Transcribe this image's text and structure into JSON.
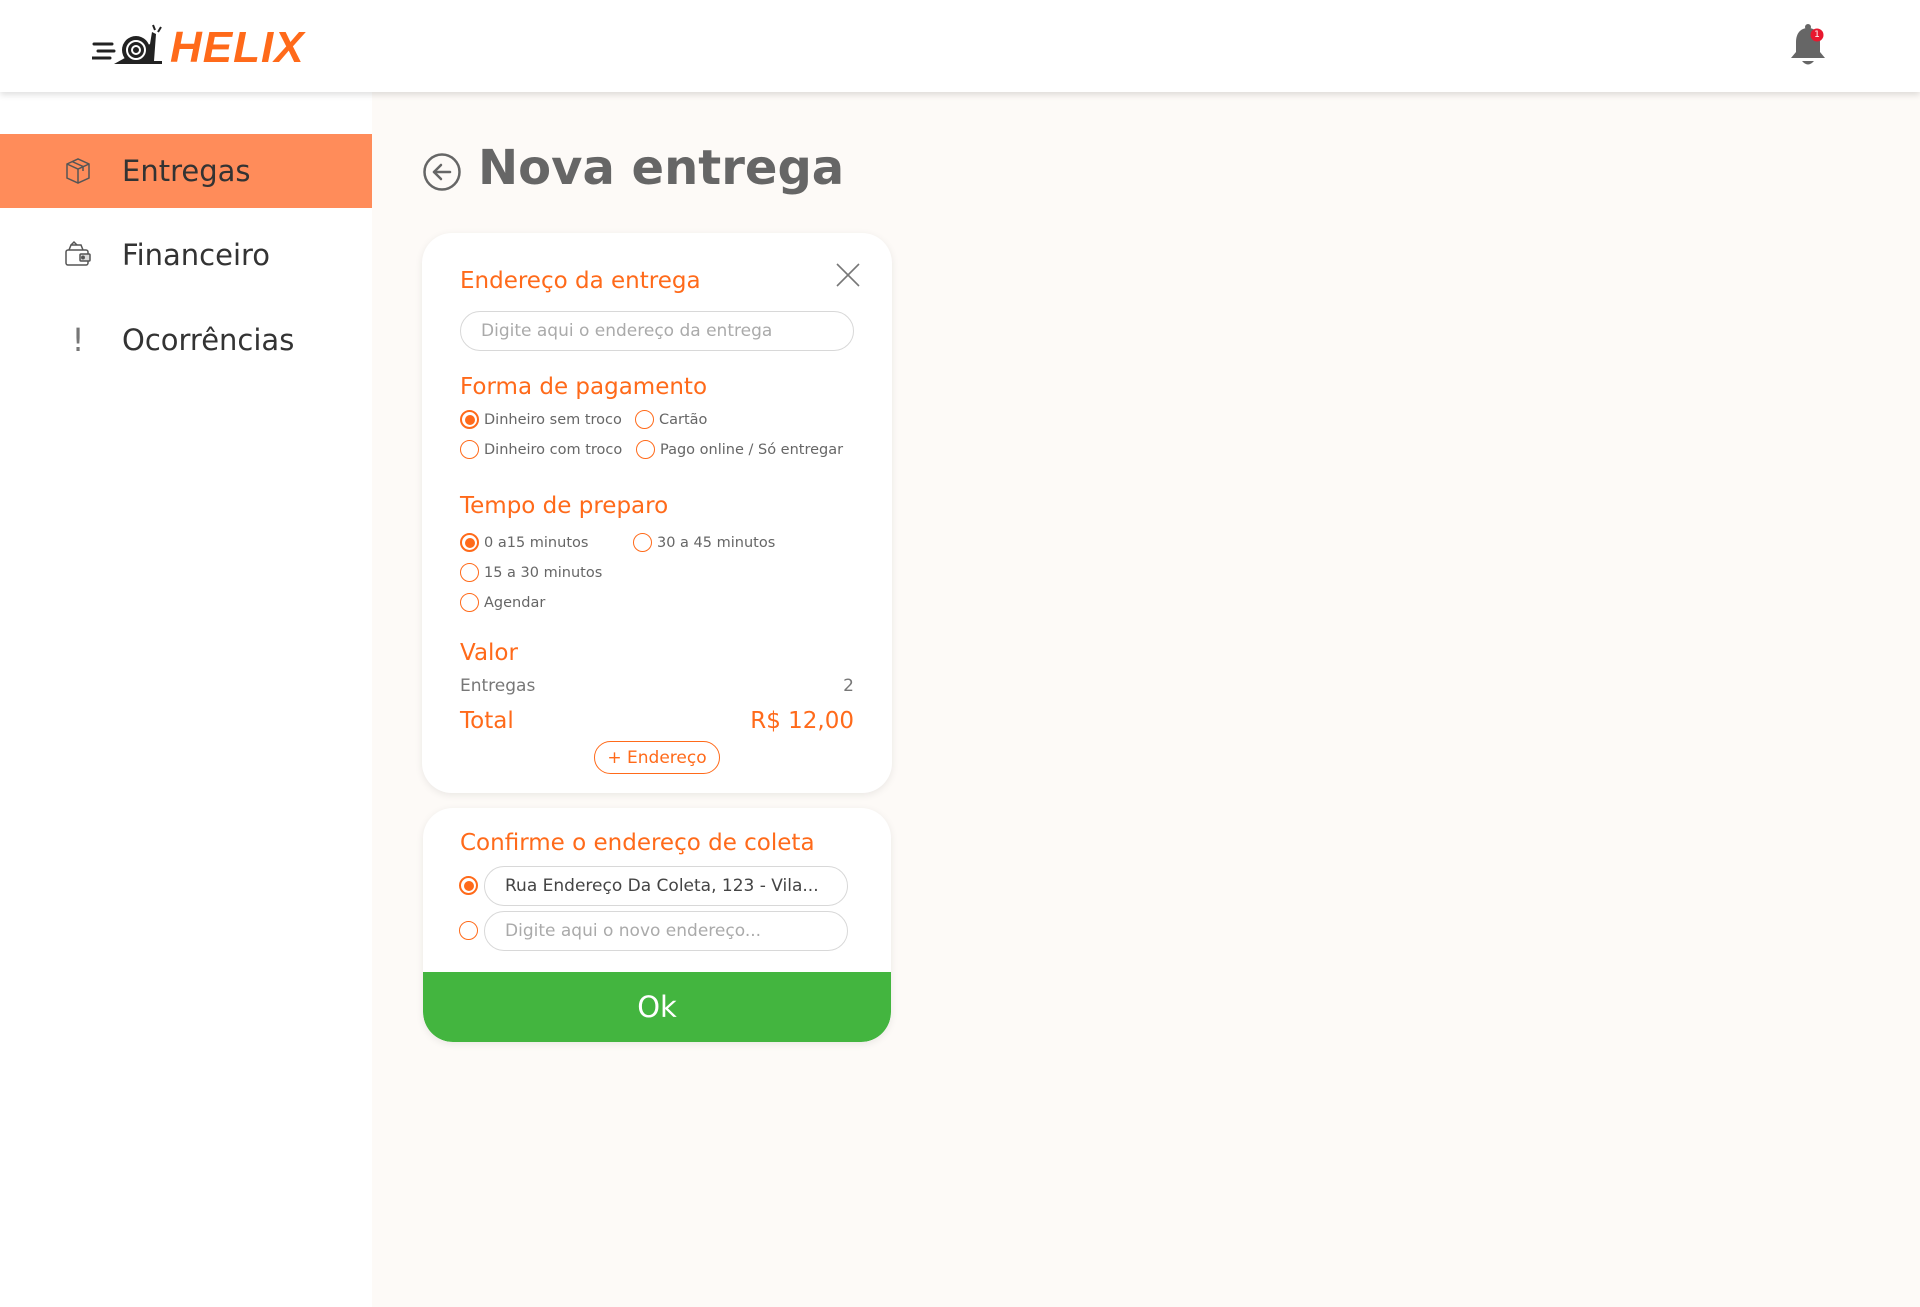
{
  "header": {
    "logo_text": "HELIX",
    "notification_count": "1",
    "brand_color": "#ff6a1a"
  },
  "sidebar": {
    "items": [
      {
        "label": "Entregas",
        "icon": "package-icon",
        "active": true
      },
      {
        "label": "Financeiro",
        "icon": "wallet-icon",
        "active": false
      },
      {
        "label": "Ocorrências",
        "icon": "exclamation-icon",
        "active": false
      }
    ],
    "active_color": "#ff8c5a"
  },
  "page": {
    "title": "Nova entrega"
  },
  "delivery_form": {
    "address_title": "Endereço da entrega",
    "address_placeholder": "Digite aqui o endereço da entrega",
    "payment_title": "Forma de pagamento",
    "payment_options": [
      {
        "label": "Dinheiro sem troco",
        "checked": true
      },
      {
        "label": "Cartão",
        "checked": false
      },
      {
        "label": "Dinheiro com troco",
        "checked": false
      },
      {
        "label": "Pago online / Só entregar",
        "checked": false
      }
    ],
    "prep_title": "Tempo de preparo",
    "prep_options": [
      {
        "label": "0 a15 minutos",
        "checked": true
      },
      {
        "label": "30 a 45 minutos",
        "checked": false
      },
      {
        "label": "15 a 30 minutos",
        "checked": false
      },
      {
        "label": "Agendar",
        "checked": false
      }
    ],
    "value_title": "Valor",
    "deliveries_label": "Entregas",
    "deliveries_count": "2",
    "total_label": "Total",
    "total_value": "R$ 12,00",
    "add_address_label": "+ Endereço"
  },
  "pickup_form": {
    "title": "Confirme o endereço de coleta",
    "current_address": "Rua Endereço Da Coleta, 123 - Vila...",
    "new_address_placeholder": "Digite aqui o novo endereço...",
    "ok_label": "Ok",
    "ok_color": "#43b53f"
  }
}
